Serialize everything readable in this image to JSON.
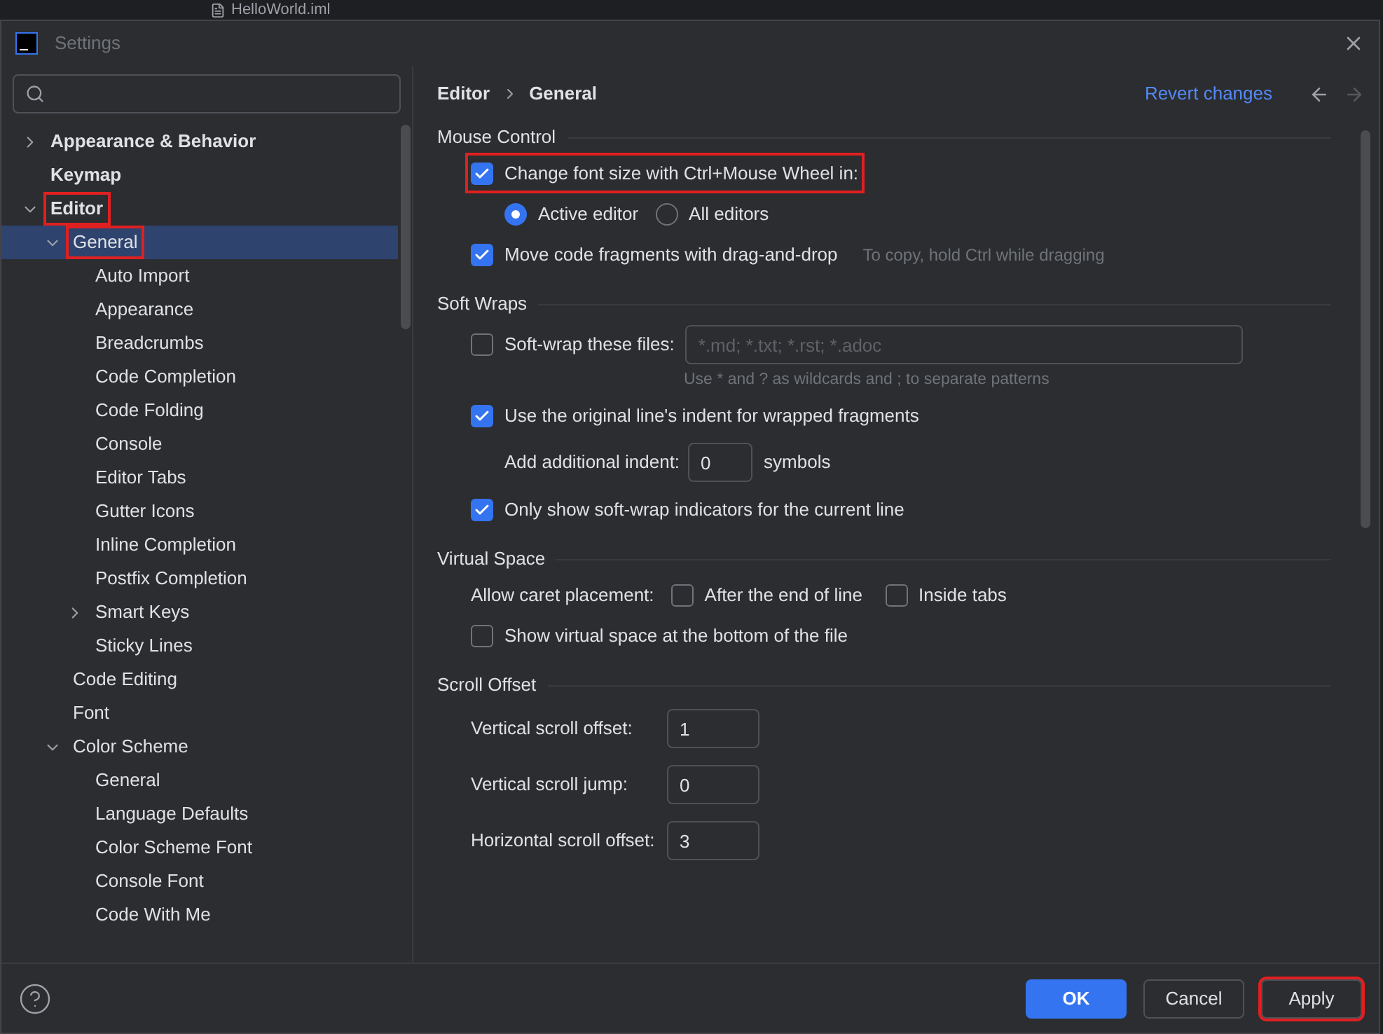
{
  "background": {
    "tab_title": "HelloWorld.iml"
  },
  "window": {
    "title": "Settings"
  },
  "sidebar": {
    "items": [
      {
        "label": "Appearance & Behavior",
        "expanded": false,
        "selected": false,
        "highlighted": false
      },
      {
        "label": "Keymap",
        "selected": false,
        "highlighted": false
      },
      {
        "label": "Editor",
        "expanded": true,
        "selected": false,
        "highlighted": true,
        "children": [
          {
            "label": "General",
            "expanded": true,
            "selected": true,
            "highlighted": true,
            "children": [
              {
                "label": "Auto Import",
                "selected": false,
                "highlighted": false
              },
              {
                "label": "Appearance",
                "selected": false,
                "highlighted": false
              },
              {
                "label": "Breadcrumbs",
                "selected": false,
                "highlighted": false
              },
              {
                "label": "Code Completion",
                "selected": false,
                "highlighted": false
              },
              {
                "label": "Code Folding",
                "selected": false,
                "highlighted": false
              },
              {
                "label": "Console",
                "selected": false,
                "highlighted": false
              },
              {
                "label": "Editor Tabs",
                "selected": false,
                "highlighted": false
              },
              {
                "label": "Gutter Icons",
                "selected": false,
                "highlighted": false
              },
              {
                "label": "Inline Completion",
                "selected": false,
                "highlighted": false
              },
              {
                "label": "Postfix Completion",
                "selected": false,
                "highlighted": false
              },
              {
                "label": "Smart Keys",
                "expanded": false,
                "selected": false,
                "highlighted": false
              },
              {
                "label": "Sticky Lines",
                "selected": false,
                "highlighted": false
              }
            ]
          },
          {
            "label": "Code Editing",
            "selected": false,
            "highlighted": false
          },
          {
            "label": "Font",
            "selected": false,
            "highlighted": false
          },
          {
            "label": "Color Scheme",
            "expanded": true,
            "selected": false,
            "highlighted": false,
            "children": [
              {
                "label": "General",
                "selected": false,
                "highlighted": false
              },
              {
                "label": "Language Defaults",
                "selected": false,
                "highlighted": false
              },
              {
                "label": "Color Scheme Font",
                "selected": false,
                "highlighted": false
              },
              {
                "label": "Console Font",
                "selected": false,
                "highlighted": false
              },
              {
                "label": "Code With Me",
                "selected": false,
                "highlighted": false
              }
            ]
          }
        ]
      }
    ]
  },
  "breadcrumb": [
    "Editor",
    "General"
  ],
  "revert_link": "Revert changes",
  "sections": [
    {
      "title": "Mouse Control",
      "rows": [
        {
          "kind": "checkbox",
          "label": "Change font size with Ctrl+Mouse Wheel in:",
          "checked": true,
          "highlighted": true
        },
        {
          "kind": "radios",
          "options": [
            {
              "label": "Active editor",
              "selected": true
            },
            {
              "label": "All editors",
              "selected": false
            }
          ]
        },
        {
          "kind": "checkbox",
          "label": "Move code fragments with drag-and-drop",
          "checked": true,
          "highlighted": false,
          "hint": "To copy, hold Ctrl while dragging"
        }
      ]
    },
    {
      "title": "Soft Wraps",
      "rows": [
        {
          "kind": "checkfield",
          "label": "Soft-wrap these files:",
          "checked": false,
          "placeholder": "*.md; *.txt; *.rst; *.adoc",
          "note": "Use * and ? as wildcards and ; to separate patterns"
        },
        {
          "kind": "checkbox",
          "label": "Use the original line's indent for wrapped fragments",
          "checked": true,
          "highlighted": false
        },
        {
          "kind": "number",
          "label": "Add additional indent:",
          "value": "0",
          "suffix": "symbols"
        },
        {
          "kind": "checkbox",
          "label": "Only show soft-wrap indicators for the current line",
          "checked": true,
          "highlighted": false
        }
      ]
    },
    {
      "title": "Virtual Space",
      "rows": [
        {
          "kind": "checkgroup",
          "label": "Allow caret placement:",
          "options": [
            {
              "label": "After the end of line",
              "checked": false
            },
            {
              "label": "Inside tabs",
              "checked": false
            }
          ]
        },
        {
          "kind": "checkbox",
          "label": "Show virtual space at the bottom of the file",
          "checked": false,
          "highlighted": false
        }
      ]
    },
    {
      "title": "Scroll Offset",
      "rows": [
        {
          "kind": "field",
          "label": "Vertical scroll offset:",
          "value": "1"
        },
        {
          "kind": "field",
          "label": "Vertical scroll jump:",
          "value": "0"
        },
        {
          "kind": "field",
          "label": "Horizontal scroll offset:",
          "value": "3"
        }
      ]
    }
  ],
  "buttons": [
    {
      "label": "OK",
      "primary": true,
      "highlighted": false
    },
    {
      "label": "Cancel",
      "primary": false,
      "highlighted": false
    },
    {
      "label": "Apply",
      "primary": false,
      "highlighted": true
    }
  ]
}
